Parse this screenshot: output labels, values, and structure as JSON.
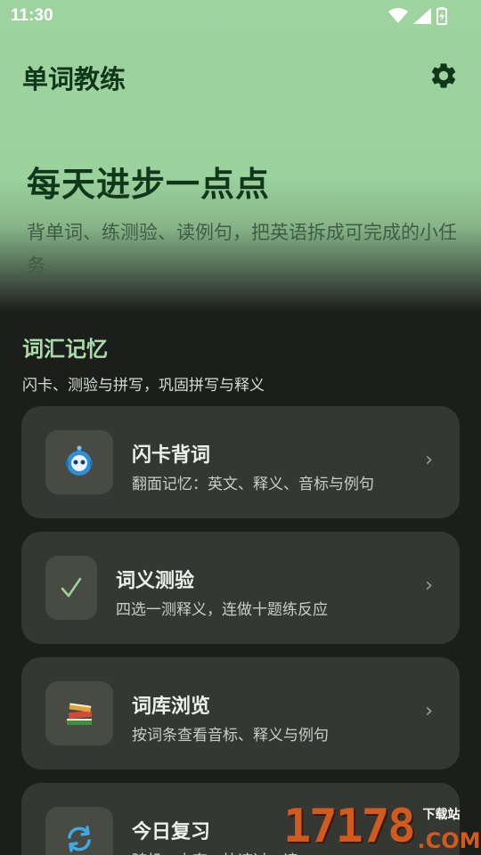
{
  "status_bar": {
    "time": "11:30"
  },
  "app": {
    "title": "单词教练"
  },
  "hero": {
    "headline": "每天进步一点点",
    "subline": "背单词、练测验、读例句，把英语拆成可完成的小任务"
  },
  "section": {
    "title": "词汇记忆",
    "description": "闪卡、测验与拼写，巩固拼写与释义"
  },
  "cards": [
    {
      "title": "闪卡背词",
      "subtitle": "翻面记忆：英文、释义、音标与例句",
      "icon": "robot-icon"
    },
    {
      "title": "词义测验",
      "subtitle": "四选一测释义，连做十题练反应",
      "icon": "checkmark-icon"
    },
    {
      "title": "词库浏览",
      "subtitle": "按词条查看音标、释义与例句",
      "icon": "books-icon"
    },
    {
      "title": "今日复习",
      "subtitle": "随机、少套、快速过一遍",
      "icon": "refresh-icon"
    }
  ],
  "chevron": "›",
  "watermark": {
    "number": "17178",
    "tag": "下载站",
    "domain": ".COM"
  },
  "colors": {
    "hero_green": "#9ed3a0",
    "title_green": "#10371a",
    "section_title": "#a8dca9",
    "card_bg": "#353832",
    "background": "#1c1e1b"
  }
}
